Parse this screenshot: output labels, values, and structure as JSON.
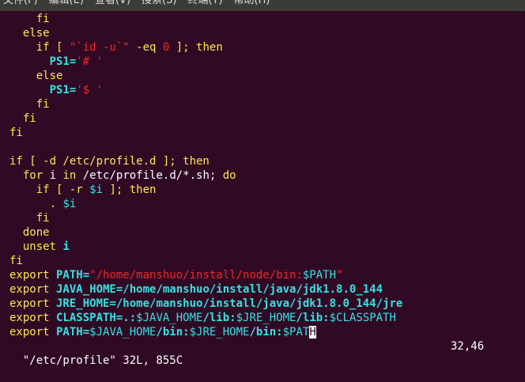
{
  "menubar": {
    "items": [
      "文件(F)",
      "编辑(E)",
      "查看(V)",
      "搜索(S)",
      "终端(T)",
      "帮助(H)"
    ]
  },
  "lines": [
    {
      "indent": "    ",
      "segments": [
        {
          "t": "fi",
          "c": "kw"
        }
      ]
    },
    {
      "indent": "  ",
      "segments": [
        {
          "t": "else",
          "c": "kw"
        }
      ]
    },
    {
      "indent": "    ",
      "segments": [
        {
          "t": "if",
          "c": "kw"
        },
        {
          "t": " [ ",
          "c": "kw"
        },
        {
          "t": "\"`id -u`\"",
          "c": "str"
        },
        {
          "t": " -eq ",
          "c": "kw"
        },
        {
          "t": "0",
          "c": "str"
        },
        {
          "t": " ]; then",
          "c": "kw"
        }
      ]
    },
    {
      "indent": "      ",
      "segments": [
        {
          "t": "PS1",
          "c": "vb"
        },
        {
          "t": "=",
          "c": "vb"
        },
        {
          "t": "'# '",
          "c": "str"
        }
      ]
    },
    {
      "indent": "    ",
      "segments": [
        {
          "t": "else",
          "c": "kw"
        }
      ]
    },
    {
      "indent": "      ",
      "segments": [
        {
          "t": "PS1",
          "c": "vb"
        },
        {
          "t": "=",
          "c": "vb"
        },
        {
          "t": "'$ '",
          "c": "str"
        }
      ]
    },
    {
      "indent": "    ",
      "segments": [
        {
          "t": "fi",
          "c": "kw"
        }
      ]
    },
    {
      "indent": "  ",
      "segments": [
        {
          "t": "fi",
          "c": "kw"
        }
      ]
    },
    {
      "indent": "",
      "segments": [
        {
          "t": "fi",
          "c": "kw"
        }
      ]
    },
    {
      "indent": "",
      "segments": []
    },
    {
      "indent": "",
      "segments": [
        {
          "t": "if",
          "c": "kw"
        },
        {
          "t": " [ -d /etc/profile.d ]; then",
          "c": "kw"
        }
      ]
    },
    {
      "indent": "  ",
      "segments": [
        {
          "t": "for",
          "c": "kw"
        },
        {
          "t": " i ",
          "c": ""
        },
        {
          "t": "in",
          "c": "kw"
        },
        {
          "t": " /etc/profile.d/*.sh; ",
          "c": ""
        },
        {
          "t": "do",
          "c": "kw"
        }
      ]
    },
    {
      "indent": "    ",
      "segments": [
        {
          "t": "if",
          "c": "kw"
        },
        {
          "t": " [ -r ",
          "c": "kw"
        },
        {
          "t": "$i",
          "c": "var"
        },
        {
          "t": " ]; then",
          "c": "kw"
        }
      ]
    },
    {
      "indent": "      ",
      "segments": [
        {
          "t": ". ",
          "c": "kw"
        },
        {
          "t": "$i",
          "c": "var"
        }
      ]
    },
    {
      "indent": "    ",
      "segments": [
        {
          "t": "fi",
          "c": "kw"
        }
      ]
    },
    {
      "indent": "  ",
      "segments": [
        {
          "t": "done",
          "c": "kw"
        }
      ]
    },
    {
      "indent": "  ",
      "segments": [
        {
          "t": "unset",
          "c": "kw"
        },
        {
          "t": " i",
          "c": "vb"
        }
      ]
    },
    {
      "indent": "",
      "segments": [
        {
          "t": "fi",
          "c": "kw"
        }
      ]
    },
    {
      "indent": "",
      "segments": [
        {
          "t": "export",
          "c": "kw"
        },
        {
          "t": " PATH=",
          "c": "vb"
        },
        {
          "t": "\"/home/manshuo/install/node/bin:",
          "c": "str"
        },
        {
          "t": "$PATH",
          "c": "var"
        },
        {
          "t": "\"",
          "c": "str"
        }
      ]
    },
    {
      "indent": "",
      "segments": [
        {
          "t": "export",
          "c": "kw"
        },
        {
          "t": " JAVA_HOME=/home/manshuo/install/java/jdk1.8.0_144",
          "c": "vb"
        }
      ]
    },
    {
      "indent": "",
      "segments": [
        {
          "t": "export",
          "c": "kw"
        },
        {
          "t": " JRE_HOME=/home/manshuo/install/java/jdk1.8.0_144/jre",
          "c": "vb"
        }
      ]
    },
    {
      "indent": "",
      "segments": [
        {
          "t": "export",
          "c": "kw"
        },
        {
          "t": " CLASSPATH=.:",
          "c": "vb"
        },
        {
          "t": "$JAVA_HOME",
          "c": "var"
        },
        {
          "t": "/lib:",
          "c": "vb"
        },
        {
          "t": "$JRE_HOME",
          "c": "var"
        },
        {
          "t": "/lib:",
          "c": "vb"
        },
        {
          "t": "$CLASSPATH",
          "c": "var"
        }
      ]
    },
    {
      "indent": "",
      "segments": [
        {
          "t": "export",
          "c": "kw"
        },
        {
          "t": " PATH=",
          "c": "vb"
        },
        {
          "t": "$JAVA_HOME",
          "c": "var"
        },
        {
          "t": "/bin:",
          "c": "vb"
        },
        {
          "t": "$JRE_HOME",
          "c": "var"
        },
        {
          "t": "/bin:",
          "c": "vb"
        },
        {
          "t": "$PAT",
          "c": "var"
        },
        {
          "t": "H",
          "c": "cursor"
        }
      ]
    }
  ],
  "status": {
    "file_info": "\"/etc/profile\" 32L, 855C",
    "cursor_pos": "32,46"
  }
}
